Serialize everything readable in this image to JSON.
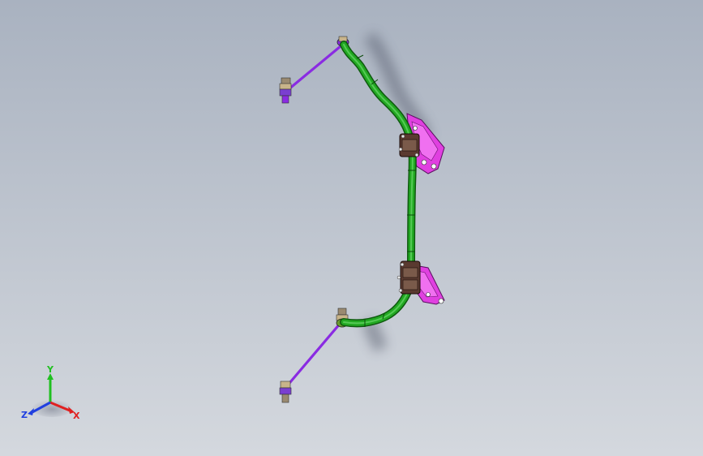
{
  "viewport": {
    "background_top": "#a9b2c0",
    "background_bottom": "#d4d8de"
  },
  "model": {
    "parts": [
      {
        "name": "stabilizer-bar",
        "color": "#1e8f1e"
      },
      {
        "name": "end-link-upper",
        "color": "#8a2be2"
      },
      {
        "name": "end-link-lower",
        "color": "#8a2be2"
      },
      {
        "name": "bracket-upper",
        "color": "#e040e0"
      },
      {
        "name": "bracket-lower",
        "color": "#e040e0"
      },
      {
        "name": "bushing-upper",
        "color": "#5a3a30"
      },
      {
        "name": "bushing-lower",
        "color": "#5a3a30"
      }
    ]
  },
  "triad": {
    "x_label": "X",
    "y_label": "Y",
    "z_label": "Z",
    "x_color": "#e02020",
    "y_color": "#20c020",
    "z_color": "#2040e0"
  }
}
